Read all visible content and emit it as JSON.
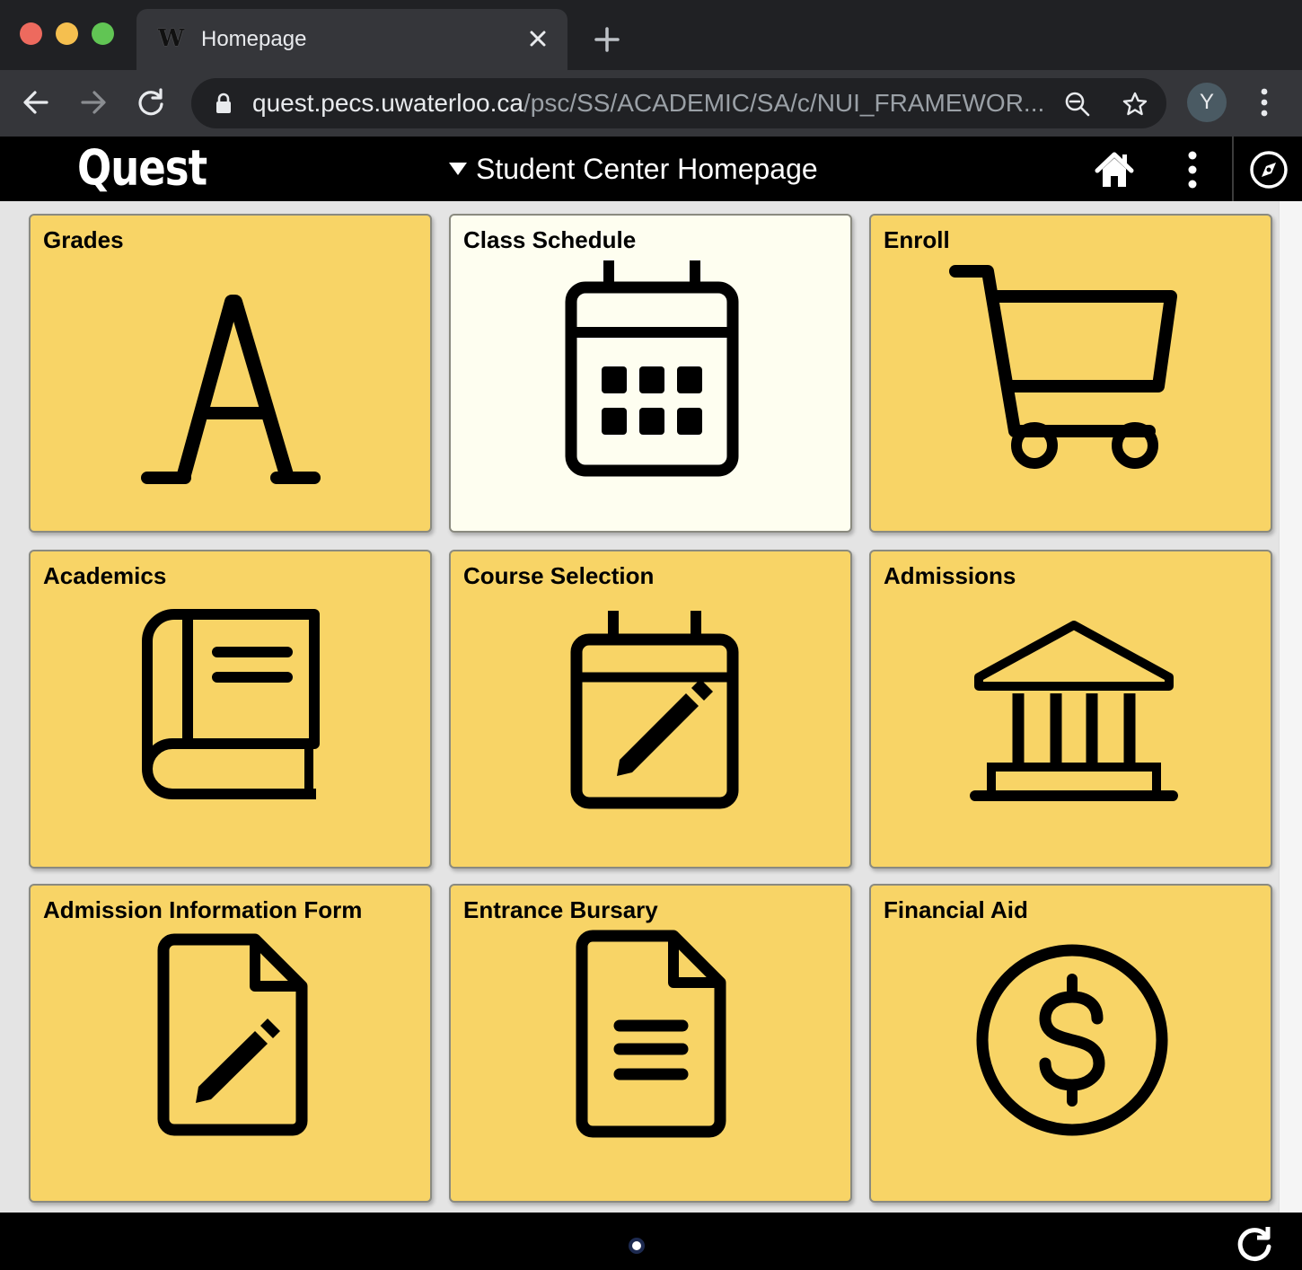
{
  "browser": {
    "tab_title": "Homepage",
    "favicon_text": "W",
    "url_host": "quest.pecs.uwaterloo.ca",
    "url_path": "/psc/SS/ACADEMIC/SA/c/NUI_FRAMEWOR...",
    "avatar_initial": "Y"
  },
  "header": {
    "logo": "Quest",
    "title": "Student Center Homepage"
  },
  "tiles": [
    {
      "title": "Grades",
      "icon": "grade-a-icon"
    },
    {
      "title": "Class Schedule",
      "icon": "calendar-icon"
    },
    {
      "title": "Enroll",
      "icon": "cart-icon"
    },
    {
      "title": "Academics",
      "icon": "book-icon"
    },
    {
      "title": "Course Selection",
      "icon": "calendar-edit-icon"
    },
    {
      "title": "Admissions",
      "icon": "institution-icon"
    },
    {
      "title": "Admission Information Form",
      "icon": "document-edit-icon"
    },
    {
      "title": "Entrance Bursary",
      "icon": "document-icon"
    },
    {
      "title": "Financial Aid",
      "icon": "dollar-circle-icon"
    }
  ],
  "colors": {
    "tile": "#f8d466",
    "tile_highlight": "#fefef0",
    "header": "#000000"
  }
}
